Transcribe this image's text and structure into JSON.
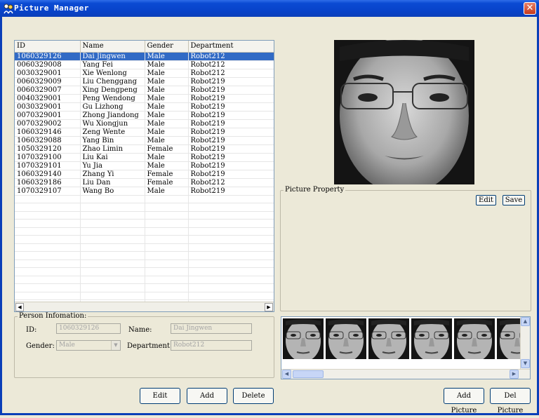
{
  "window": {
    "title": "Picture Manager",
    "close_glyph": "✕"
  },
  "table": {
    "columns": [
      "ID",
      "Name",
      "Gender",
      "Department"
    ],
    "rows": [
      [
        "1060329126",
        "Dai Jingwen",
        "Male",
        "Robot212"
      ],
      [
        "0060329008",
        "Yang Fei",
        "Male",
        "Robot212"
      ],
      [
        "0030329001",
        "Xie Wenlong",
        "Male",
        "Robot212"
      ],
      [
        "0060329009",
        "Liu Chenggang",
        "Male",
        "Robot219"
      ],
      [
        "0060329007",
        "Xing Dengpeng",
        "Male",
        "Robot219"
      ],
      [
        "0040329001",
        "Peng Wendong",
        "Male",
        "Robot219"
      ],
      [
        "0030329001",
        "Gu Lizhong",
        "Male",
        "Robot219"
      ],
      [
        "0070329001",
        "Zhong Jiandong",
        "Male",
        "Robot219"
      ],
      [
        "0070329002",
        "Wu Xiongjun",
        "Male",
        "Robot219"
      ],
      [
        "1060329146",
        "Zeng Wente",
        "Male",
        "Robot219"
      ],
      [
        "1060329088",
        "Yang Bin",
        "Male",
        "Robot219"
      ],
      [
        "1050329120",
        "Zhao Limin",
        "Female",
        "Robot219"
      ],
      [
        "1070329100",
        "Liu Kai",
        "Male",
        "Robot219"
      ],
      [
        "1070329101",
        "Yu Jia",
        "Male",
        "Robot219"
      ],
      [
        "1060329140",
        "Zhang Yi",
        "Female",
        "Robot219"
      ],
      [
        "1060329186",
        "Liu Dan",
        "Female",
        "Robot212"
      ],
      [
        "1070329107",
        "Wang Bo",
        "Male",
        "Robot219"
      ]
    ],
    "selected_index": 0,
    "empty_rows": 14
  },
  "person_info": {
    "legend": "Person Infomation:",
    "id_label": "ID:",
    "id_value": "1060329126",
    "name_label": "Name:",
    "name_value": "Dai Jingwen",
    "gender_label": "Gender:",
    "gender_value": "Male",
    "department_label": "Department:",
    "department_value": "Robot212"
  },
  "buttons": {
    "edit": "Edit",
    "add": "Add",
    "delete": "Delete",
    "add_picture": "Add Picture",
    "del_picture": "Del Picture"
  },
  "picture_property": {
    "legend": "Picture Property",
    "edit": "Edit",
    "save": "Save"
  },
  "thumbnails_count": 6,
  "colors": {
    "selection": "#316ac5",
    "titlebar": "#0842c8",
    "window_bg": "#ece9d8"
  }
}
